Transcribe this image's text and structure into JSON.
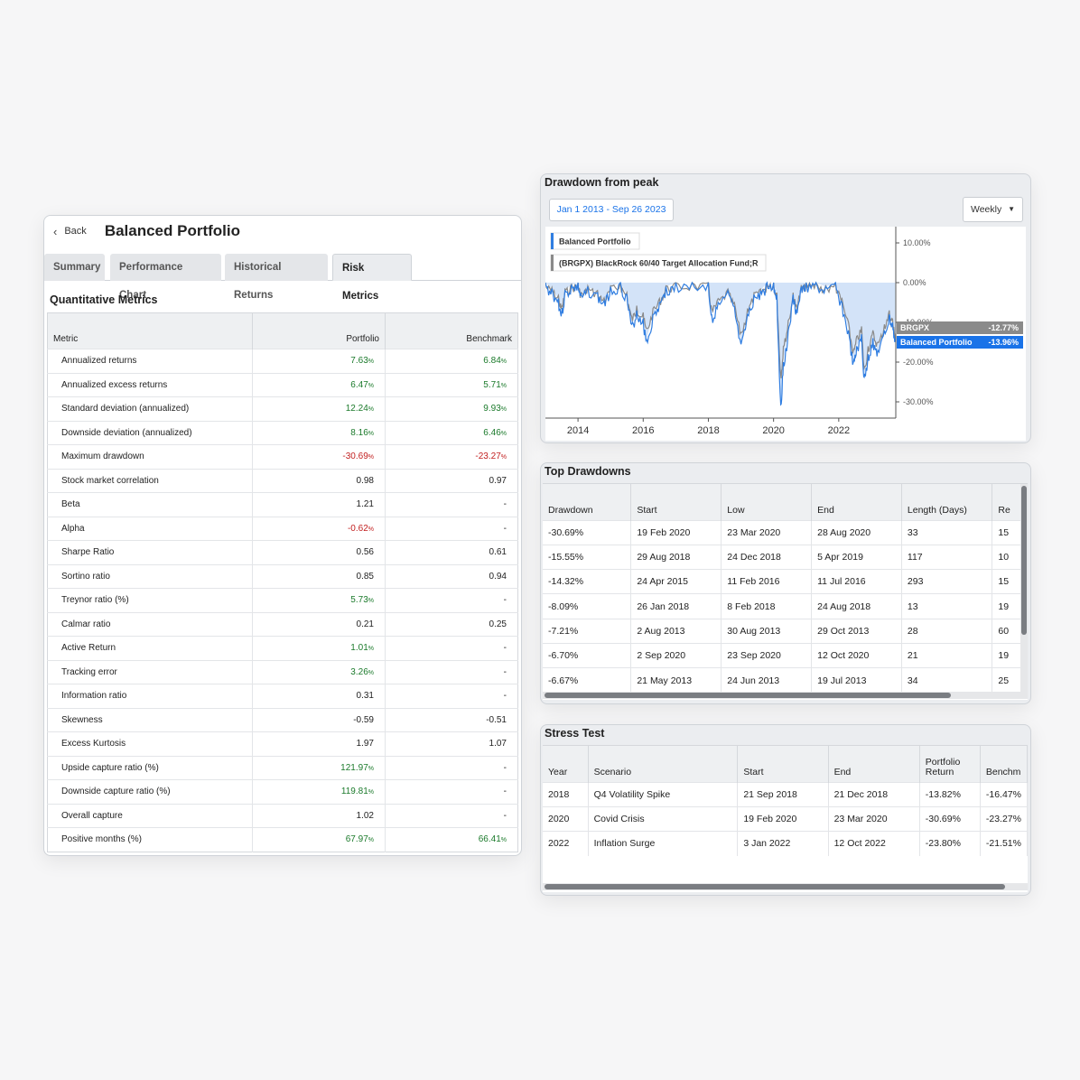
{
  "left_panel": {
    "back_label": "Back",
    "title": "Balanced Portfolio",
    "tabs": [
      {
        "label": "Summary"
      },
      {
        "label": "Performance Chart"
      },
      {
        "label": "Historical Returns"
      },
      {
        "label": "Risk Metrics",
        "active": true
      }
    ],
    "section_title": "Quantitative Metrics",
    "columns": [
      "Metric",
      "Portfolio",
      "Benchmark"
    ],
    "rows": [
      {
        "metric": "Annualized returns",
        "portfolio": "7.63",
        "portfolio_unit": "%",
        "portfolio_tone": "pos",
        "benchmark": "6.84",
        "benchmark_unit": "%",
        "benchmark_tone": "pos"
      },
      {
        "metric": "Annualized excess returns",
        "portfolio": "6.47",
        "portfolio_unit": "%",
        "portfolio_tone": "pos",
        "benchmark": "5.71",
        "benchmark_unit": "%",
        "benchmark_tone": "pos"
      },
      {
        "metric": "Standard deviation (annualized)",
        "portfolio": "12.24",
        "portfolio_unit": "%",
        "portfolio_tone": "pos",
        "benchmark": "9.93",
        "benchmark_unit": "%",
        "benchmark_tone": "pos"
      },
      {
        "metric": "Downside deviation (annualized)",
        "portfolio": "8.16",
        "portfolio_unit": "%",
        "portfolio_tone": "pos",
        "benchmark": "6.46",
        "benchmark_unit": "%",
        "benchmark_tone": "pos"
      },
      {
        "metric": "Maximum drawdown",
        "portfolio": "-30.69",
        "portfolio_unit": "%",
        "portfolio_tone": "neg",
        "benchmark": "-23.27",
        "benchmark_unit": "%",
        "benchmark_tone": "neg"
      },
      {
        "metric": "Stock market correlation",
        "portfolio": "0.98",
        "portfolio_unit": "",
        "portfolio_tone": "",
        "benchmark": "0.97",
        "benchmark_unit": "",
        "benchmark_tone": ""
      },
      {
        "metric": "Beta",
        "portfolio": "1.21",
        "portfolio_unit": "",
        "portfolio_tone": "",
        "benchmark": "-",
        "benchmark_unit": "",
        "benchmark_tone": ""
      },
      {
        "metric": "Alpha",
        "portfolio": "-0.62",
        "portfolio_unit": "%",
        "portfolio_tone": "neg",
        "benchmark": "-",
        "benchmark_unit": "",
        "benchmark_tone": ""
      },
      {
        "metric": "Sharpe Ratio",
        "portfolio": "0.56",
        "portfolio_unit": "",
        "portfolio_tone": "",
        "benchmark": "0.61",
        "benchmark_unit": "",
        "benchmark_tone": ""
      },
      {
        "metric": "Sortino ratio",
        "portfolio": "0.85",
        "portfolio_unit": "",
        "portfolio_tone": "",
        "benchmark": "0.94",
        "benchmark_unit": "",
        "benchmark_tone": ""
      },
      {
        "metric": "Treynor ratio (%)",
        "portfolio": "5.73",
        "portfolio_unit": "%",
        "portfolio_tone": "pos",
        "benchmark": "-",
        "benchmark_unit": "",
        "benchmark_tone": ""
      },
      {
        "metric": "Calmar ratio",
        "portfolio": "0.21",
        "portfolio_unit": "",
        "portfolio_tone": "",
        "benchmark": "0.25",
        "benchmark_unit": "",
        "benchmark_tone": ""
      },
      {
        "metric": "Active Return",
        "portfolio": "1.01",
        "portfolio_unit": "%",
        "portfolio_tone": "pos",
        "benchmark": "-",
        "benchmark_unit": "",
        "benchmark_tone": ""
      },
      {
        "metric": "Tracking error",
        "portfolio": "3.26",
        "portfolio_unit": "%",
        "portfolio_tone": "pos",
        "benchmark": "-",
        "benchmark_unit": "",
        "benchmark_tone": ""
      },
      {
        "metric": "Information ratio",
        "portfolio": "0.31",
        "portfolio_unit": "",
        "portfolio_tone": "",
        "benchmark": "-",
        "benchmark_unit": "",
        "benchmark_tone": ""
      },
      {
        "metric": "Skewness",
        "portfolio": "-0.59",
        "portfolio_unit": "",
        "portfolio_tone": "",
        "benchmark": "-0.51",
        "benchmark_unit": "",
        "benchmark_tone": ""
      },
      {
        "metric": "Excess Kurtosis",
        "portfolio": "1.97",
        "portfolio_unit": "",
        "portfolio_tone": "",
        "benchmark": "1.07",
        "benchmark_unit": "",
        "benchmark_tone": ""
      },
      {
        "metric": "Upside capture ratio (%)",
        "portfolio": "121.97",
        "portfolio_unit": "%",
        "portfolio_tone": "pos",
        "benchmark": "-",
        "benchmark_unit": "",
        "benchmark_tone": ""
      },
      {
        "metric": "Downside capture ratio (%)",
        "portfolio": "119.81",
        "portfolio_unit": "%",
        "portfolio_tone": "pos",
        "benchmark": "-",
        "benchmark_unit": "",
        "benchmark_tone": ""
      },
      {
        "metric": "Overall capture",
        "portfolio": "1.02",
        "portfolio_unit": "",
        "portfolio_tone": "",
        "benchmark": "-",
        "benchmark_unit": "",
        "benchmark_tone": ""
      },
      {
        "metric": "Positive months (%)",
        "portfolio": "67.97",
        "portfolio_unit": "%",
        "portfolio_tone": "pos",
        "benchmark": "66.41",
        "benchmark_unit": "%",
        "benchmark_tone": "pos"
      }
    ]
  },
  "drawdown_chart": {
    "title": "Drawdown from peak",
    "date_range": "Jan 1 2013 - Sep 26 2023",
    "frequency": "Weekly",
    "colors": {
      "portfolio": "#2f7de1",
      "benchmark": "#8a8a8a",
      "fill": "#d3e3f8"
    },
    "chart_data": {
      "type": "area",
      "x_ticks": [
        "2014",
        "2016",
        "2018",
        "2020",
        "2022"
      ],
      "y_ticks": [
        "10.00%",
        "0.00%",
        "-10.00%",
        "-20.00%",
        "-30.00%"
      ],
      "ylim": [
        -31,
        12
      ],
      "xlim": [
        2013.0,
        2023.75
      ],
      "legend": [
        "Balanced Portfolio",
        "(BRGPX) BlackRock 60/40 Target Allocation Fund;R"
      ],
      "end_labels": [
        {
          "name": "BRGPX",
          "value": "-12.77%"
        },
        {
          "name": "Balanced Portfolio",
          "value": "-13.96%"
        }
      ],
      "series": [
        {
          "name": "Balanced Portfolio",
          "points": [
            [
              2013.0,
              0
            ],
            [
              2013.2,
              -1.5
            ],
            [
              2013.4,
              -4
            ],
            [
              2013.5,
              -7.2
            ],
            [
              2013.6,
              -2
            ],
            [
              2013.8,
              -0.5
            ],
            [
              2014.0,
              0
            ],
            [
              2014.1,
              -3
            ],
            [
              2014.3,
              -1
            ],
            [
              2014.6,
              -2.5
            ],
            [
              2014.8,
              -4.5
            ],
            [
              2015.0,
              -1
            ],
            [
              2015.3,
              0
            ],
            [
              2015.5,
              -3
            ],
            [
              2015.65,
              -10.5
            ],
            [
              2015.8,
              -7
            ],
            [
              2016.0,
              -9
            ],
            [
              2016.1,
              -14.3
            ],
            [
              2016.3,
              -8
            ],
            [
              2016.5,
              -5
            ],
            [
              2016.7,
              -1
            ],
            [
              2017.0,
              0
            ],
            [
              2017.5,
              0
            ],
            [
              2018.0,
              0
            ],
            [
              2018.1,
              -8.1
            ],
            [
              2018.3,
              -5
            ],
            [
              2018.6,
              -2
            ],
            [
              2018.8,
              -6
            ],
            [
              2019.0,
              -15.5
            ],
            [
              2019.2,
              -8
            ],
            [
              2019.4,
              -3
            ],
            [
              2019.6,
              -2
            ],
            [
              2019.8,
              0
            ],
            [
              2020.0,
              0
            ],
            [
              2020.1,
              -3
            ],
            [
              2020.22,
              -30.7
            ],
            [
              2020.3,
              -20
            ],
            [
              2020.45,
              -12
            ],
            [
              2020.6,
              -3
            ],
            [
              2020.7,
              -6.7
            ],
            [
              2020.85,
              -1
            ],
            [
              2021.0,
              0
            ],
            [
              2021.3,
              0
            ],
            [
              2021.6,
              -1
            ],
            [
              2021.9,
              0
            ],
            [
              2022.1,
              -5
            ],
            [
              2022.3,
              -12
            ],
            [
              2022.45,
              -20
            ],
            [
              2022.55,
              -16
            ],
            [
              2022.7,
              -13
            ],
            [
              2022.78,
              -23.8
            ],
            [
              2022.9,
              -18
            ],
            [
              2023.05,
              -14
            ],
            [
              2023.2,
              -17
            ],
            [
              2023.4,
              -12
            ],
            [
              2023.55,
              -8
            ],
            [
              2023.65,
              -10
            ],
            [
              2023.73,
              -13.96
            ]
          ]
        },
        {
          "name": "BRGPX",
          "points": [
            [
              2013.0,
              0
            ],
            [
              2013.2,
              -1.2
            ],
            [
              2013.4,
              -3.2
            ],
            [
              2013.5,
              -6
            ],
            [
              2013.6,
              -1.6
            ],
            [
              2013.8,
              -0.4
            ],
            [
              2014.0,
              0
            ],
            [
              2014.1,
              -2.5
            ],
            [
              2014.3,
              -0.8
            ],
            [
              2014.6,
              -2
            ],
            [
              2014.8,
              -3.8
            ],
            [
              2015.0,
              -0.8
            ],
            [
              2015.3,
              0
            ],
            [
              2015.5,
              -2.5
            ],
            [
              2015.65,
              -8.5
            ],
            [
              2015.8,
              -5.8
            ],
            [
              2016.0,
              -7.5
            ],
            [
              2016.1,
              -11.5
            ],
            [
              2016.3,
              -6.5
            ],
            [
              2016.5,
              -4
            ],
            [
              2016.7,
              -0.8
            ],
            [
              2017.0,
              0
            ],
            [
              2017.5,
              0
            ],
            [
              2018.0,
              0
            ],
            [
              2018.1,
              -6.5
            ],
            [
              2018.3,
              -4
            ],
            [
              2018.6,
              -1.6
            ],
            [
              2018.8,
              -5
            ],
            [
              2019.0,
              -12.5
            ],
            [
              2019.2,
              -6.5
            ],
            [
              2019.4,
              -2.5
            ],
            [
              2019.6,
              -1.6
            ],
            [
              2019.8,
              0
            ],
            [
              2020.0,
              0
            ],
            [
              2020.1,
              -2.5
            ],
            [
              2020.22,
              -23.3
            ],
            [
              2020.3,
              -16
            ],
            [
              2020.45,
              -9.5
            ],
            [
              2020.6,
              -2.5
            ],
            [
              2020.7,
              -5.5
            ],
            [
              2020.85,
              -0.8
            ],
            [
              2021.0,
              0
            ],
            [
              2021.3,
              0
            ],
            [
              2021.6,
              -0.8
            ],
            [
              2021.9,
              0
            ],
            [
              2022.1,
              -4
            ],
            [
              2022.3,
              -10
            ],
            [
              2022.45,
              -17
            ],
            [
              2022.55,
              -13.5
            ],
            [
              2022.7,
              -11
            ],
            [
              2022.78,
              -21.5
            ],
            [
              2022.9,
              -16
            ],
            [
              2023.05,
              -12
            ],
            [
              2023.2,
              -15
            ],
            [
              2023.4,
              -10.5
            ],
            [
              2023.55,
              -7
            ],
            [
              2023.65,
              -9
            ],
            [
              2023.73,
              -12.77
            ]
          ]
        }
      ]
    }
  },
  "top_drawdowns": {
    "title": "Top Drawdowns",
    "columns": [
      "Drawdown",
      "Start",
      "Low",
      "End",
      "Length (Days)",
      "Re"
    ],
    "rows": [
      [
        "-30.69%",
        "19 Feb 2020",
        "23 Mar 2020",
        "28 Aug 2020",
        "33",
        "15"
      ],
      [
        "-15.55%",
        "29 Aug 2018",
        "24 Dec 2018",
        "5 Apr 2019",
        "117",
        "10"
      ],
      [
        "-14.32%",
        "24 Apr 2015",
        "11 Feb 2016",
        "11 Jul 2016",
        "293",
        "15"
      ],
      [
        "-8.09%",
        "26 Jan 2018",
        "8 Feb 2018",
        "24 Aug 2018",
        "13",
        "19"
      ],
      [
        "-7.21%",
        "2 Aug 2013",
        "30 Aug 2013",
        "29 Oct 2013",
        "28",
        "60"
      ],
      [
        "-6.70%",
        "2 Sep 2020",
        "23 Sep 2020",
        "12 Oct 2020",
        "21",
        "19"
      ],
      [
        "-6.67%",
        "21 May 2013",
        "24 Jun 2013",
        "19 Jul 2013",
        "34",
        "25"
      ]
    ]
  },
  "stress_test": {
    "title": "Stress Test",
    "columns": [
      "Year",
      "Scenario",
      "Start",
      "End",
      "Portfolio Return",
      "Benchm"
    ],
    "rows": [
      [
        "2018",
        "Q4 Volatility Spike",
        "21 Sep 2018",
        "21 Dec 2018",
        "-13.82%",
        "-16.47%"
      ],
      [
        "2020",
        "Covid Crisis",
        "19 Feb 2020",
        "23 Mar 2020",
        "-30.69%",
        "-23.27%"
      ],
      [
        "2022",
        "Inflation Surge",
        "3 Jan 2022",
        "12 Oct 2022",
        "-23.80%",
        "-21.51%"
      ]
    ]
  }
}
